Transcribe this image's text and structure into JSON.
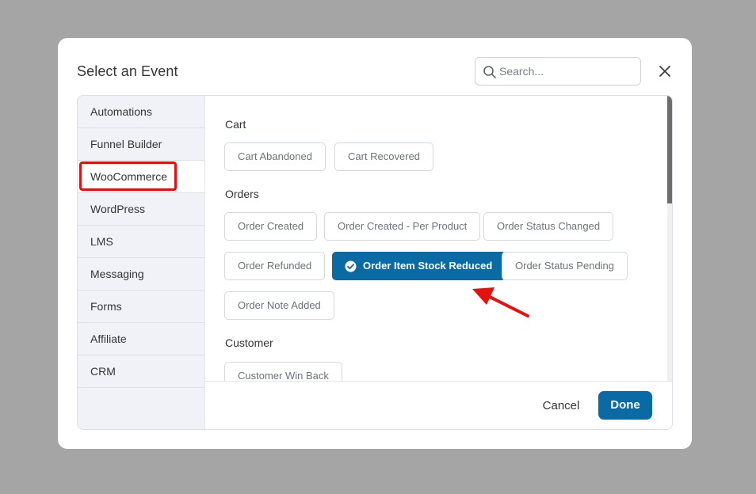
{
  "modal": {
    "title": "Select an Event",
    "search_placeholder": "Search...",
    "close_icon": "close-icon"
  },
  "sidebar": {
    "items": [
      {
        "label": "Automations"
      },
      {
        "label": "Funnel Builder"
      },
      {
        "label": "WooCommerce",
        "active": true
      },
      {
        "label": "WordPress"
      },
      {
        "label": "LMS"
      },
      {
        "label": "Messaging"
      },
      {
        "label": "Forms"
      },
      {
        "label": "Affiliate"
      },
      {
        "label": "CRM"
      }
    ]
  },
  "sections": [
    {
      "title": "Cart",
      "events": [
        "Cart Abandoned",
        "Cart Recovered"
      ]
    },
    {
      "title": "Orders",
      "events": [
        "Order Created",
        "Order Created - Per Product",
        "Order Status Changed",
        "Order Refunded",
        "Order Item Stock Reduced",
        "Order Status Pending",
        "Order Note Added"
      ]
    },
    {
      "title": "Customer",
      "events": [
        "Customer Win Back"
      ]
    }
  ],
  "selected_event": "Order Item Stock Reduced",
  "footer": {
    "cancel_label": "Cancel",
    "done_label": "Done"
  },
  "colors": {
    "accent": "#0a6aa3",
    "highlight": "#e30e0e",
    "overlay": "#a5a5a5"
  }
}
